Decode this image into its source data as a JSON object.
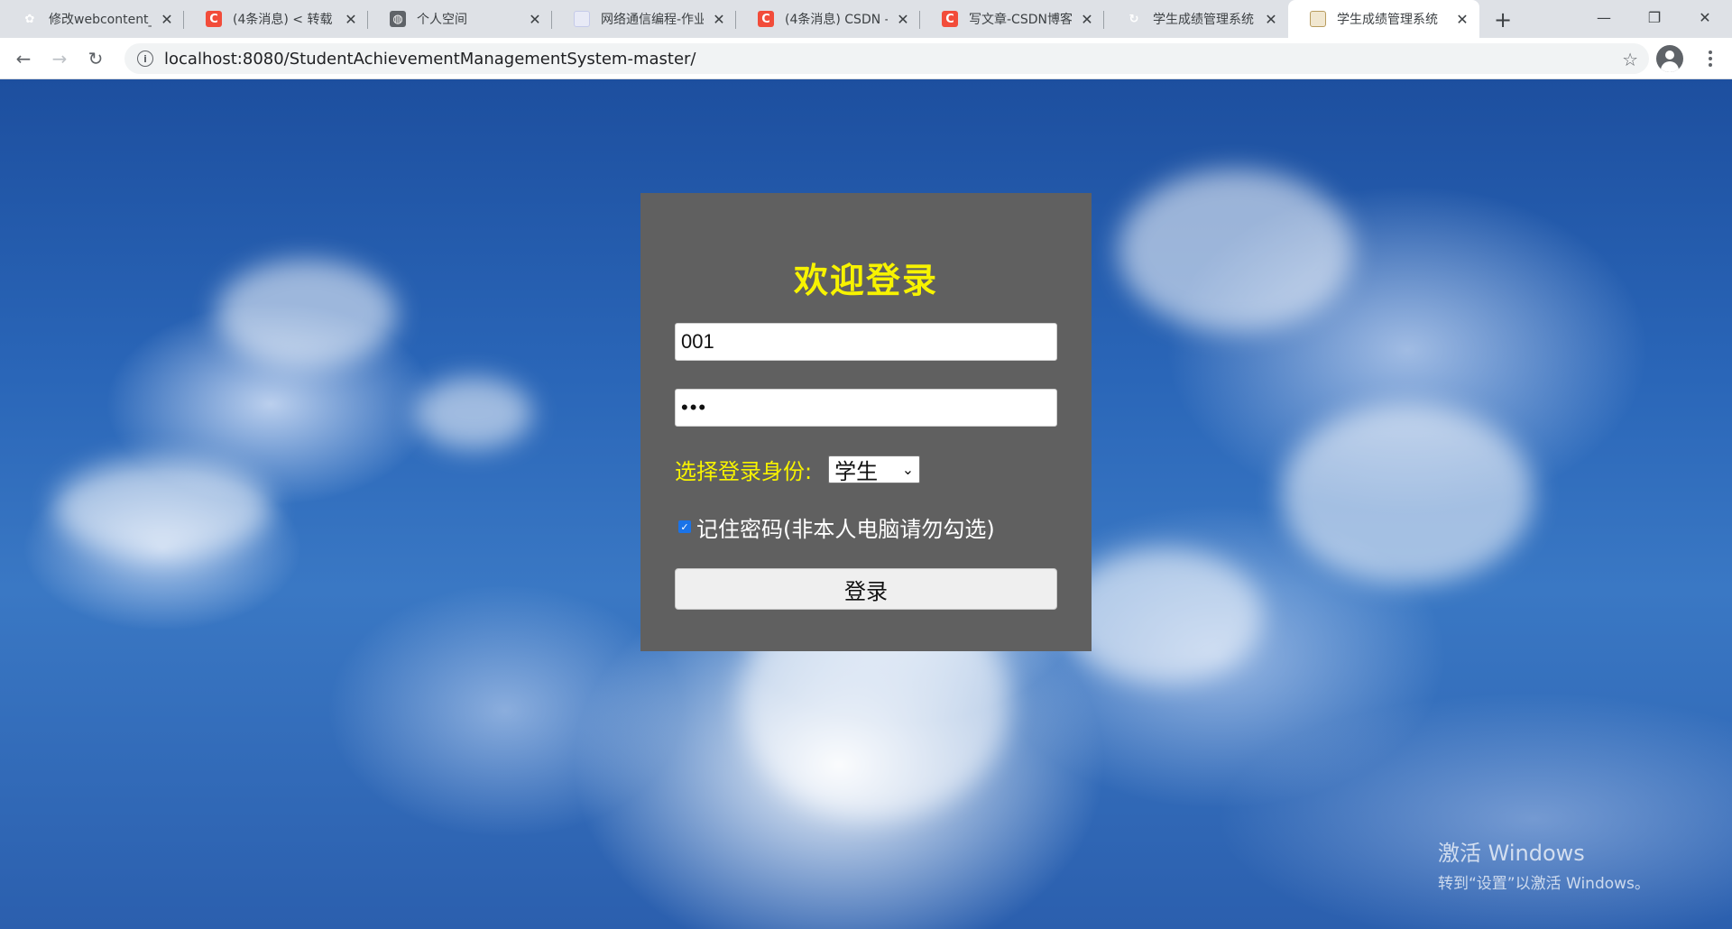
{
  "browser": {
    "tabs": [
      {
        "title": "修改webcontent_",
        "favicon": "paw-icon",
        "active": false
      },
      {
        "title": "(4条消息) < 转载 >",
        "favicon": "csdn-icon",
        "active": false
      },
      {
        "title": "个人空间",
        "favicon": "globe-icon",
        "active": false
      },
      {
        "title": "网络通信编程-作业",
        "favicon": "page-icon",
        "active": false
      },
      {
        "title": "(4条消息) CSDN -",
        "favicon": "csdn-icon",
        "active": false
      },
      {
        "title": "写文章-CSDN博客",
        "favicon": "csdn-icon",
        "active": false
      },
      {
        "title": "学生成绩管理系统",
        "favicon": "ring-icon",
        "active": false
      },
      {
        "title": "学生成绩管理系统",
        "favicon": "image-icon",
        "active": true
      }
    ],
    "close_glyph": "✕",
    "new_tab_glyph": "+",
    "window_controls": {
      "minimize": "—",
      "restore": "❐",
      "close": "✕"
    },
    "nav": {
      "back": "←",
      "forward": "→",
      "reload": "↻"
    },
    "url": "localhost:8080/StudentAchievementManagementSystem-master/",
    "info_glyph": "i",
    "star_glyph": "☆"
  },
  "login": {
    "title": "欢迎登录",
    "username_value": "001",
    "password_value": "•••",
    "role_label": "选择登录身份:",
    "role_selected": "学生",
    "role_chevron": "⌄",
    "checkbox_checked": true,
    "check_glyph": "✓",
    "remember_label": "记住密码(非本人电脑请勿勾选)",
    "login_button": "登录"
  },
  "watermark": {
    "line1": "激活 Windows",
    "line2": "转到“设置”以激活 Windows。"
  },
  "colors": {
    "card_bg": "#606060",
    "title_yellow": "#f7f300",
    "sky_blue": "#2a66b8"
  }
}
